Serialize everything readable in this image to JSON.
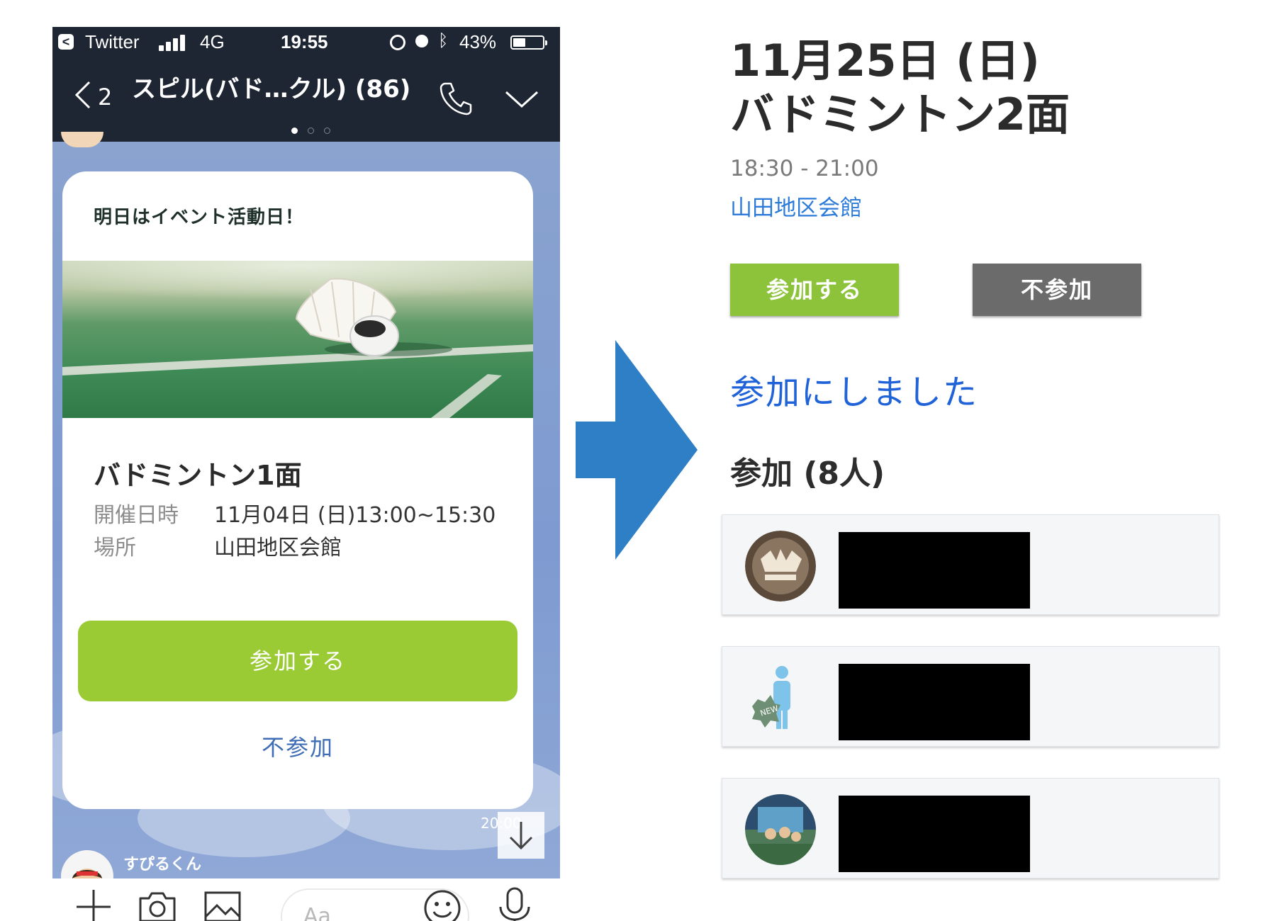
{
  "statusbar": {
    "back_app": "Twitter",
    "network": "4G",
    "time": "19:55",
    "battery": "43%",
    "battery_level": 0.43
  },
  "chat": {
    "back_count": "2",
    "title": "スピル(バド…クル) (86)",
    "page_dots": 3,
    "active_dot": 1
  },
  "event_card": {
    "header": "明日はイベント活動日！",
    "title": "バドミントン1面",
    "datetime_label": "開催日時",
    "datetime_value": "11月04日 (日)13:00~15:30",
    "place_label": "場所",
    "place_value": "山田地区会館",
    "join_button": "参加する",
    "decline_button": "不参加",
    "message_time": "20:00"
  },
  "next_message": {
    "sender": "すぴるくん"
  },
  "input": {
    "placeholder": "Aa"
  },
  "detail": {
    "title_line1": "11月25日 (日)",
    "title_line2": "バドミントン2面",
    "time": "18:30 - 21:00",
    "place": "山田地区会館",
    "join_button": "参加する",
    "decline_button": "不参加",
    "status": "参加にしました",
    "participants_heading": "参加 (8人)",
    "participants": [
      {
        "avatar": "emblem-avatar"
      },
      {
        "avatar": "default-new-avatar"
      },
      {
        "avatar": "group-photo-avatar"
      }
    ]
  },
  "colors": {
    "line_green": "#9acb34",
    "navbar_bg": "#1e2533",
    "chat_bg": "#8aa3cf",
    "link_blue": "#2d7bd9",
    "status_blue": "#2063d9",
    "decline_gray": "#6b6b6b",
    "arrow_blue": "#2f7fc6"
  }
}
